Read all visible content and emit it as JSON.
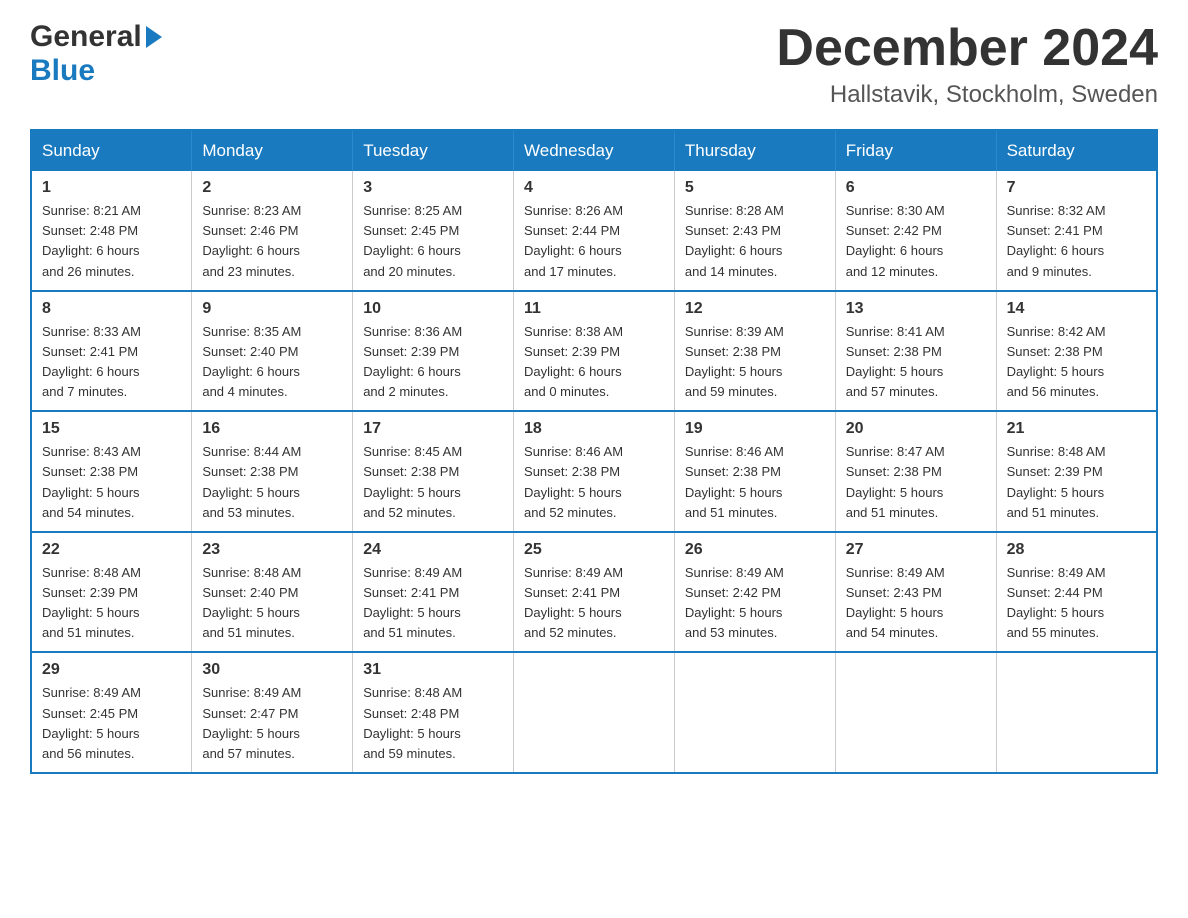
{
  "header": {
    "logo_general": "General",
    "logo_blue": "Blue",
    "month_title": "December 2024",
    "subtitle": "Hallstavik, Stockholm, Sweden"
  },
  "weekdays": [
    "Sunday",
    "Monday",
    "Tuesday",
    "Wednesday",
    "Thursday",
    "Friday",
    "Saturday"
  ],
  "weeks": [
    [
      {
        "day": "1",
        "info": "Sunrise: 8:21 AM\nSunset: 2:48 PM\nDaylight: 6 hours\nand 26 minutes."
      },
      {
        "day": "2",
        "info": "Sunrise: 8:23 AM\nSunset: 2:46 PM\nDaylight: 6 hours\nand 23 minutes."
      },
      {
        "day": "3",
        "info": "Sunrise: 8:25 AM\nSunset: 2:45 PM\nDaylight: 6 hours\nand 20 minutes."
      },
      {
        "day": "4",
        "info": "Sunrise: 8:26 AM\nSunset: 2:44 PM\nDaylight: 6 hours\nand 17 minutes."
      },
      {
        "day": "5",
        "info": "Sunrise: 8:28 AM\nSunset: 2:43 PM\nDaylight: 6 hours\nand 14 minutes."
      },
      {
        "day": "6",
        "info": "Sunrise: 8:30 AM\nSunset: 2:42 PM\nDaylight: 6 hours\nand 12 minutes."
      },
      {
        "day": "7",
        "info": "Sunrise: 8:32 AM\nSunset: 2:41 PM\nDaylight: 6 hours\nand 9 minutes."
      }
    ],
    [
      {
        "day": "8",
        "info": "Sunrise: 8:33 AM\nSunset: 2:41 PM\nDaylight: 6 hours\nand 7 minutes."
      },
      {
        "day": "9",
        "info": "Sunrise: 8:35 AM\nSunset: 2:40 PM\nDaylight: 6 hours\nand 4 minutes."
      },
      {
        "day": "10",
        "info": "Sunrise: 8:36 AM\nSunset: 2:39 PM\nDaylight: 6 hours\nand 2 minutes."
      },
      {
        "day": "11",
        "info": "Sunrise: 8:38 AM\nSunset: 2:39 PM\nDaylight: 6 hours\nand 0 minutes."
      },
      {
        "day": "12",
        "info": "Sunrise: 8:39 AM\nSunset: 2:38 PM\nDaylight: 5 hours\nand 59 minutes."
      },
      {
        "day": "13",
        "info": "Sunrise: 8:41 AM\nSunset: 2:38 PM\nDaylight: 5 hours\nand 57 minutes."
      },
      {
        "day": "14",
        "info": "Sunrise: 8:42 AM\nSunset: 2:38 PM\nDaylight: 5 hours\nand 56 minutes."
      }
    ],
    [
      {
        "day": "15",
        "info": "Sunrise: 8:43 AM\nSunset: 2:38 PM\nDaylight: 5 hours\nand 54 minutes."
      },
      {
        "day": "16",
        "info": "Sunrise: 8:44 AM\nSunset: 2:38 PM\nDaylight: 5 hours\nand 53 minutes."
      },
      {
        "day": "17",
        "info": "Sunrise: 8:45 AM\nSunset: 2:38 PM\nDaylight: 5 hours\nand 52 minutes."
      },
      {
        "day": "18",
        "info": "Sunrise: 8:46 AM\nSunset: 2:38 PM\nDaylight: 5 hours\nand 52 minutes."
      },
      {
        "day": "19",
        "info": "Sunrise: 8:46 AM\nSunset: 2:38 PM\nDaylight: 5 hours\nand 51 minutes."
      },
      {
        "day": "20",
        "info": "Sunrise: 8:47 AM\nSunset: 2:38 PM\nDaylight: 5 hours\nand 51 minutes."
      },
      {
        "day": "21",
        "info": "Sunrise: 8:48 AM\nSunset: 2:39 PM\nDaylight: 5 hours\nand 51 minutes."
      }
    ],
    [
      {
        "day": "22",
        "info": "Sunrise: 8:48 AM\nSunset: 2:39 PM\nDaylight: 5 hours\nand 51 minutes."
      },
      {
        "day": "23",
        "info": "Sunrise: 8:48 AM\nSunset: 2:40 PM\nDaylight: 5 hours\nand 51 minutes."
      },
      {
        "day": "24",
        "info": "Sunrise: 8:49 AM\nSunset: 2:41 PM\nDaylight: 5 hours\nand 51 minutes."
      },
      {
        "day": "25",
        "info": "Sunrise: 8:49 AM\nSunset: 2:41 PM\nDaylight: 5 hours\nand 52 minutes."
      },
      {
        "day": "26",
        "info": "Sunrise: 8:49 AM\nSunset: 2:42 PM\nDaylight: 5 hours\nand 53 minutes."
      },
      {
        "day": "27",
        "info": "Sunrise: 8:49 AM\nSunset: 2:43 PM\nDaylight: 5 hours\nand 54 minutes."
      },
      {
        "day": "28",
        "info": "Sunrise: 8:49 AM\nSunset: 2:44 PM\nDaylight: 5 hours\nand 55 minutes."
      }
    ],
    [
      {
        "day": "29",
        "info": "Sunrise: 8:49 AM\nSunset: 2:45 PM\nDaylight: 5 hours\nand 56 minutes."
      },
      {
        "day": "30",
        "info": "Sunrise: 8:49 AM\nSunset: 2:47 PM\nDaylight: 5 hours\nand 57 minutes."
      },
      {
        "day": "31",
        "info": "Sunrise: 8:48 AM\nSunset: 2:48 PM\nDaylight: 5 hours\nand 59 minutes."
      },
      {
        "day": "",
        "info": ""
      },
      {
        "day": "",
        "info": ""
      },
      {
        "day": "",
        "info": ""
      },
      {
        "day": "",
        "info": ""
      }
    ]
  ]
}
